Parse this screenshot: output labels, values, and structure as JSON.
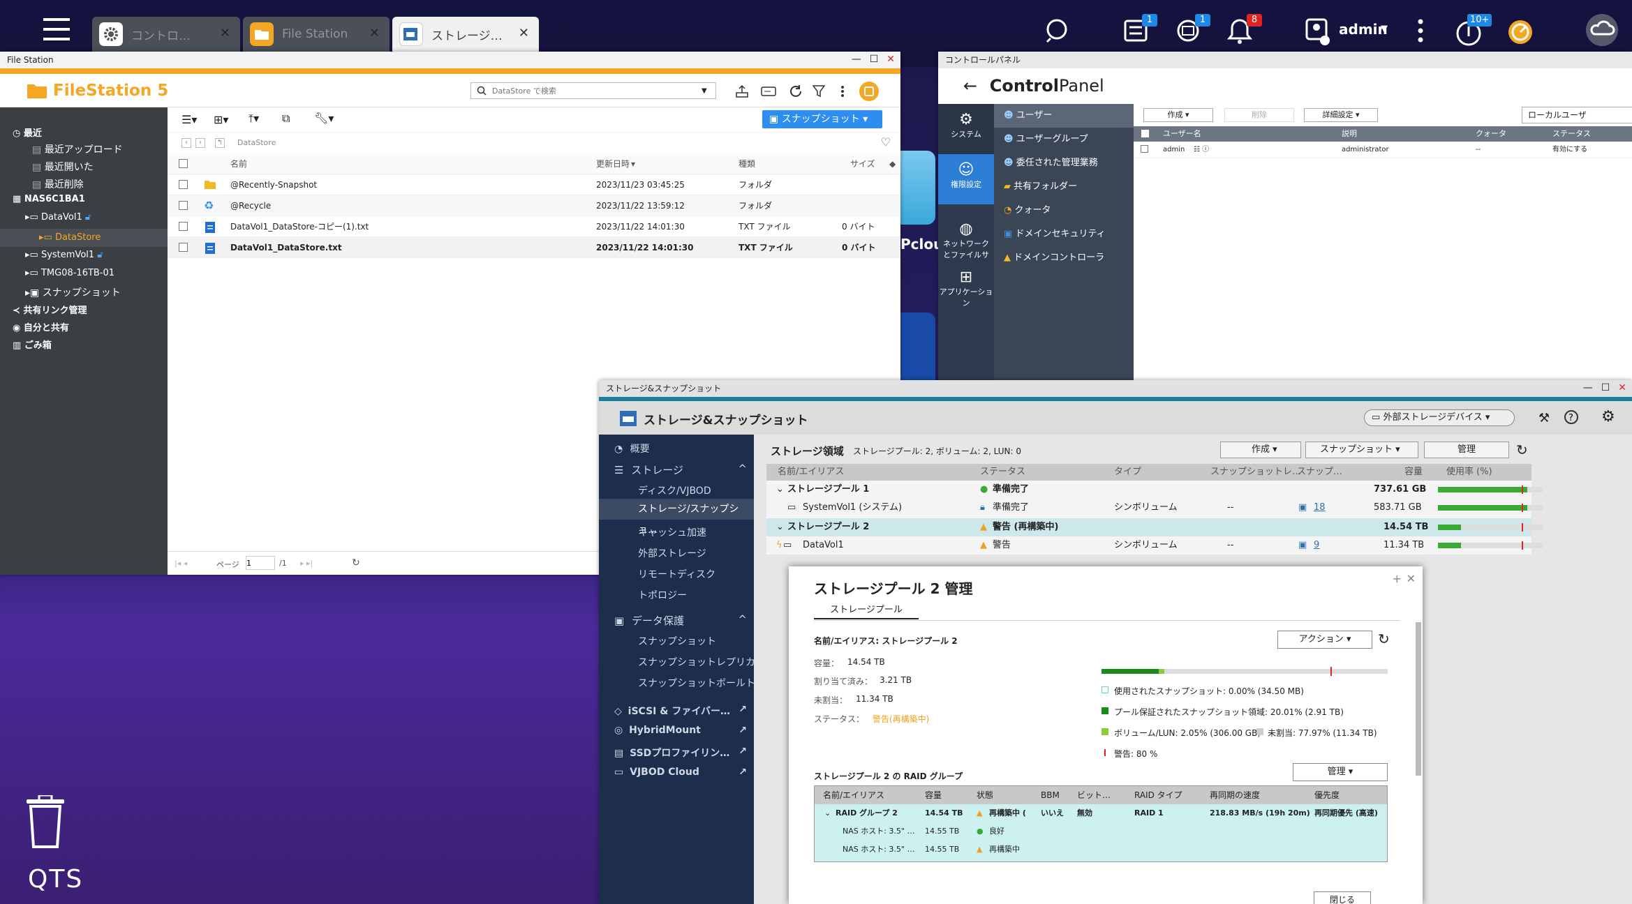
{
  "taskbar": {
    "tabs": [
      {
        "label": "コントロ…"
      },
      {
        "label": "File Station"
      },
      {
        "label": "ストレージ…"
      }
    ],
    "user": "admin",
    "badges": {
      "tasks": "1",
      "sync": "1",
      "notifications": "8",
      "updates": "10+"
    },
    "colors": {
      "notification_badge": "#e02424",
      "info_badge": "#1e88e5",
      "filestation_orange": "#f5a623"
    }
  },
  "desktop": {
    "logo_text": "QTS",
    "pcloud_text": "Pclou"
  },
  "filestation": {
    "window_title": "File Station",
    "app_title": "FileStation 5",
    "search_placeholder": "DataStore で検索",
    "snapshot_button": "スナップショット",
    "breadcrumb": "DataStore",
    "sidebar": {
      "recent": "最近",
      "recent_upload": "最近アップロード",
      "recent_opened": "最近開いた",
      "recent_deleted": "最近削除",
      "nas": "NAS6C1BA1",
      "datavol1": "DataVol1",
      "datastore": "DataStore",
      "systemvol1": "SystemVol1",
      "tmg": "TMG08-16TB-01",
      "snapshot": "スナップショット",
      "share_links": "共有リンク管理",
      "me_shared": "自分と共有",
      "trash": "ごみ箱"
    },
    "columns": {
      "name": "名前",
      "modified": "更新日時",
      "type": "種類",
      "size": "サイズ"
    },
    "rows": [
      {
        "name": "@Recently-Snapshot",
        "modified": "2023/11/23 03:45:25",
        "type": "フォルダ",
        "size": ""
      },
      {
        "name": "@Recycle",
        "modified": "2023/11/22 13:59:12",
        "type": "フォルダ",
        "size": ""
      },
      {
        "name": "DataVol1_DataStore-コピー(1).txt",
        "modified": "2023/11/22 14:01:30",
        "type": "TXT ファイル",
        "size": "0 バイト"
      },
      {
        "name": "DataVol1_DataStore.txt",
        "modified": "2023/11/22 14:01:30",
        "type": "TXT ファイル",
        "size": "0 バイト"
      }
    ],
    "pager": {
      "label": "ページ",
      "page": "1",
      "total": "/1"
    }
  },
  "controlpanel": {
    "window_title": "コントロールパネル",
    "app_title_bold": "Control",
    "app_title_rest": "Panel",
    "nav": {
      "system": "システム",
      "privilege": "権限設定",
      "network": "ネットワーク\nとファイルサ",
      "apps": "アプリケーション"
    },
    "menu": [
      "ユーザー",
      "ユーザーグループ",
      "委任された管理業務",
      "共有フォルダー",
      "クォータ",
      "ドメインセキュリティ",
      "ドメインコントローラ"
    ],
    "buttons": {
      "create": "作成",
      "delete": "削除",
      "advanced": "詳細設定"
    },
    "scope": "ローカルユーザ",
    "columns": {
      "user": "ユーザー名",
      "desc": "説明",
      "quota": "クォータ",
      "status": "ステータス"
    },
    "row": {
      "user": "admin",
      "desc": "administrator",
      "quota": "--",
      "status": "有効にする"
    }
  },
  "storage": {
    "window_title": "ストレージ&スナップショット",
    "app_title": "ストレージ&スナップショット",
    "external_button": "外部ストレージデバイス",
    "sidebar": {
      "overview": "概要",
      "storage": "ストレージ",
      "disks": "ディスク/VJBOD",
      "storage_snap": "ストレージ/スナップショ…",
      "cache": "キャッシュ加速",
      "external": "外部ストレージ",
      "remote": "リモートディスク",
      "topology": "トポロジー",
      "protection": "データ保護",
      "snapshot": "スナップショット",
      "snap_replica": "スナップショットレプリカ",
      "snap_vault": "スナップショットボールト",
      "iscsi": "iSCSI & ファイバー…",
      "hybridmount": "HybridMount",
      "ssd": "SSDプロファイリン…",
      "vjbod": "VJBOD Cloud"
    },
    "header_bold": "ストレージ領域",
    "header_rest": "ストレージプール: 2, ボリューム: 2, LUN: 0",
    "buttons": {
      "create": "作成",
      "snapshot": "スナップショット",
      "manage": "管理"
    },
    "columns": {
      "name": "名前/エイリアス",
      "status": "ステータス",
      "type": "タイプ",
      "snapshot_rep": "スナップショットレ…",
      "snap": "スナップ…",
      "capacity": "容量",
      "usage": "使用率 (%)"
    },
    "rows": [
      {
        "name": "ストレージプール 1",
        "status": "準備完了",
        "type": "",
        "rep": "",
        "snap": "",
        "capacity": "737.61 GB",
        "usage": 0.85
      },
      {
        "name": "SystemVol1 (システム)",
        "status": "準備完了",
        "type": "シンボリューム",
        "rep": "--",
        "snap": "18",
        "capacity": "583.71 GB",
        "usage": 0.85
      },
      {
        "name": "ストレージプール 2",
        "status": "警告 (再構築中)",
        "type": "",
        "rep": "",
        "snap": "",
        "capacity": "14.54 TB",
        "usage": 0.22
      },
      {
        "name": "DataVol1",
        "status": "警告",
        "type": "シンボリューム",
        "rep": "--",
        "snap": "9",
        "capacity": "11.34 TB",
        "usage": 0.22
      }
    ],
    "colors": {
      "usage_green": "#3aa935",
      "warning_orange": "#f0a020",
      "selected_row": "#cde8ea"
    }
  },
  "modal": {
    "title": "ストレージプール 2 管理",
    "tab": "ストレージプール",
    "name_label": "名前/エイリアス: ストレージプール 2",
    "action_button": "アクション",
    "capacity_label": "容量：",
    "capacity_value": "14.54 TB",
    "allocated_label": "割り当て済み：",
    "allocated_value": "3.21 TB",
    "unallocated_label": "未割当：",
    "unallocated_value": "11.34 TB",
    "status_label": "ステータス：",
    "status_value": "警告(再構築中)",
    "legend": {
      "used_snap": "使用されたスナップショット: 0.00% (34.50 MB)",
      "reserved_snap": "プール保証されたスナップショット領域: 20.01% (2.91 TB)",
      "volume": "ボリューム/LUN: 2.05% (306.00 GB)",
      "unalloc": "未割当: 77.97% (11.34 TB)",
      "warning": "警告: 80 %"
    },
    "raid_title": "ストレージプール 2 の RAID グループ",
    "manage_button": "管理",
    "raid_columns": {
      "name": "名前/エイリアス",
      "capacity": "容量",
      "state": "状態",
      "bbm": "BBM",
      "bitmap": "ビット…",
      "raid_type": "RAID タイプ",
      "speed": "再同期の速度",
      "priority": "優先度"
    },
    "raid_rows": [
      {
        "name": "RAID グループ 2",
        "capacity": "14.54 TB",
        "state": "再構築中 (",
        "bbm": "いいえ",
        "bitmap": "無効",
        "raid_type": "RAID 1",
        "speed": "218.83 MB/s (19h 20m)",
        "priority": "再同期優先 (高速)"
      },
      {
        "name": "NAS ホスト: 3.5\" …",
        "capacity": "14.55 TB",
        "state": "良好",
        "bbm": "",
        "bitmap": "",
        "raid_type": "",
        "speed": "",
        "priority": ""
      },
      {
        "name": "NAS ホスト: 3.5\" …",
        "capacity": "14.55 TB",
        "state": "再構築中",
        "bbm": "",
        "bitmap": "",
        "raid_type": "",
        "speed": "",
        "priority": ""
      }
    ],
    "close_button": "閉じる",
    "usage": {
      "reserved_snap": 0.2001,
      "volume": 0.0205,
      "unalloc": 0.7797,
      "warning": 0.8
    }
  }
}
